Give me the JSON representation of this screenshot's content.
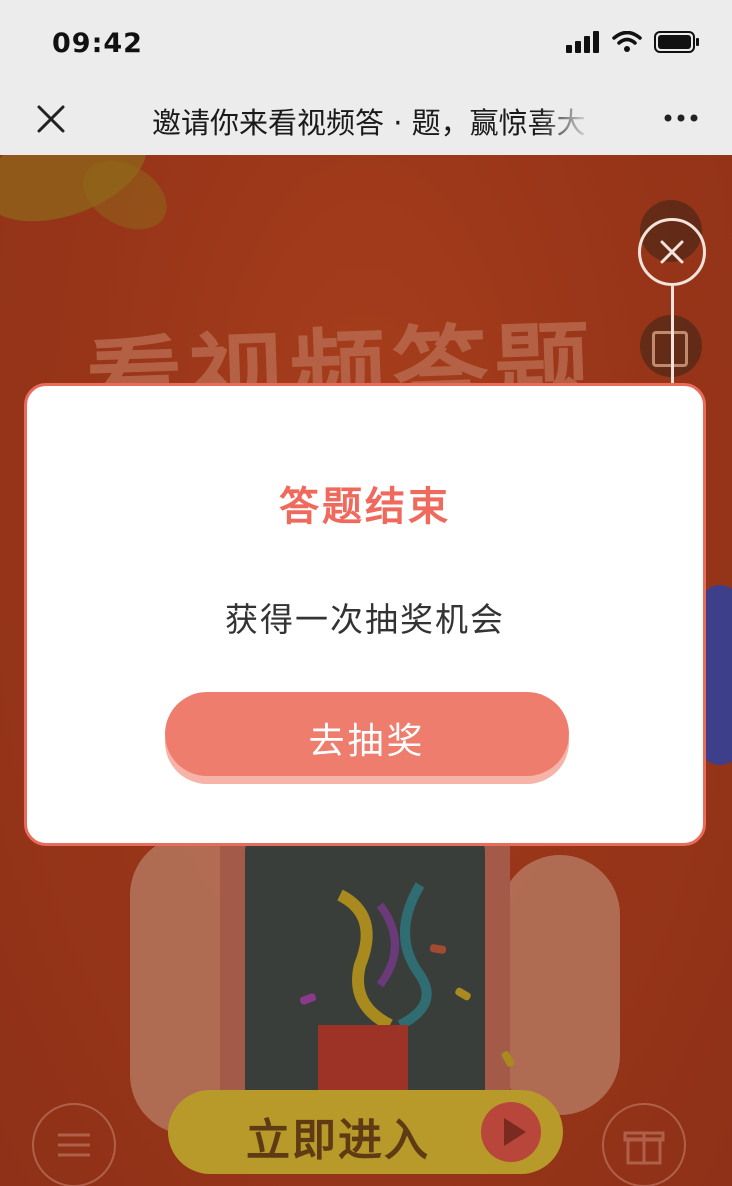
{
  "status_bar": {
    "time": "09:42"
  },
  "nav": {
    "title": "邀请你来看视频答 · 题，赢惊喜大"
  },
  "background": {
    "title": "看视频答题",
    "enter_button": "立即进入"
  },
  "modal": {
    "title": "答题结束",
    "description": "获得一次抽奖机会",
    "button": "去抽奖"
  },
  "colors": {
    "accent": "#ef6a5d",
    "button": "#ef7d6d",
    "background": "#9a3619"
  }
}
